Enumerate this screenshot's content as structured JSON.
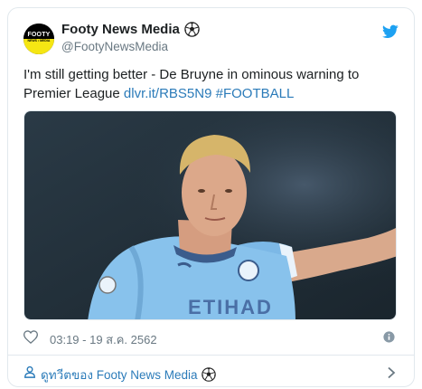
{
  "account": {
    "display_name": "Footy News Media",
    "handle": "@FootyNewsMedia",
    "avatar_text": "FOOTY",
    "avatar_subtext": "NEWS • MEDIA",
    "name_emoji_icon": "soccer-ball-icon"
  },
  "tweet": {
    "text": "I'm still getting better - De Bruyne in ominous warning to Premier League ",
    "link": "dlvr.it/RBS5N9",
    "hashtag": "#FOOTBALL",
    "media_jersey_text": "ETIHAD"
  },
  "meta": {
    "timestamp": "03:19 - 19 ส.ค. 2562",
    "like_icon": "heart-icon",
    "info_icon": "info-icon"
  },
  "footer": {
    "label": "ดูทวีตของ Footy News Media",
    "icon": "person-icon",
    "chevron": "chevron-right-icon"
  },
  "colors": {
    "link": "#2b7bb9",
    "twitter_blue": "#1da1f2",
    "muted": "#697882",
    "border": "#e1e8ed",
    "avatar_yellow": "#f5e613"
  }
}
